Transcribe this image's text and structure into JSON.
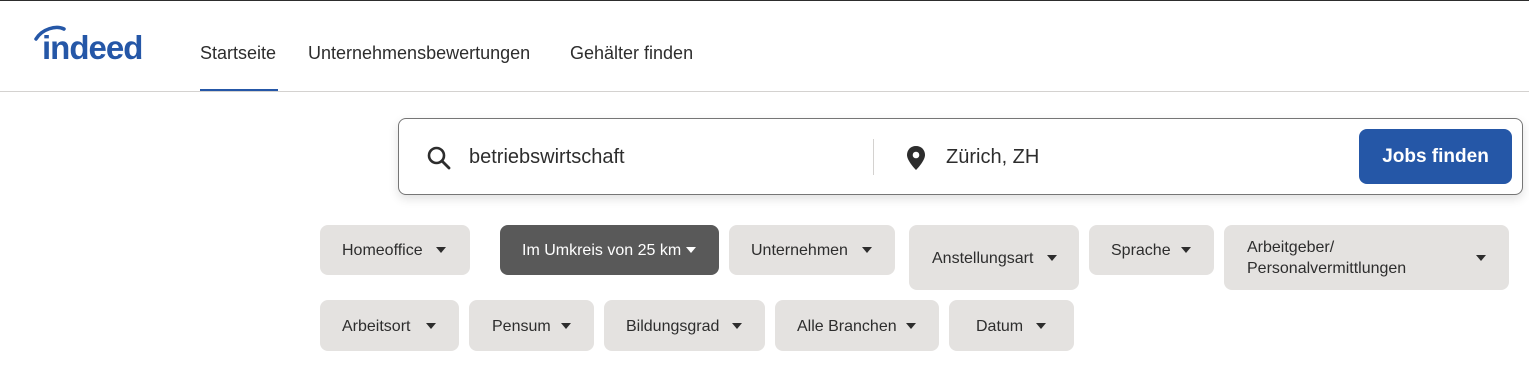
{
  "header": {
    "logo_text": "indeed",
    "nav": [
      {
        "label": "Startseite",
        "active": true
      },
      {
        "label": "Unternehmensbewertungen",
        "active": false
      },
      {
        "label": "Gehälter finden",
        "active": false
      }
    ]
  },
  "search": {
    "what_value": "betriebswirtschaft",
    "where_value": "Zürich, ZH",
    "button_label": "Jobs finden",
    "search_icon": "search-icon",
    "location_icon": "location-pin-icon"
  },
  "filters": {
    "row1": [
      {
        "label": "Homeoffice",
        "selected": false
      },
      {
        "label": "Im Umkreis von 25 km",
        "selected": true
      },
      {
        "label": "Unternehmen",
        "selected": false
      },
      {
        "label": "Anstellungsart",
        "selected": false
      },
      {
        "label": "Sprache",
        "selected": false
      },
      {
        "label_line1": "Arbeitgeber/",
        "label_line2": "Personalvermittlungen",
        "selected": false
      }
    ],
    "row2": [
      {
        "label": "Arbeitsort",
        "selected": false
      },
      {
        "label": "Pensum",
        "selected": false
      },
      {
        "label": "Bildungsgrad",
        "selected": false
      },
      {
        "label": "Alle Branchen",
        "selected": false
      },
      {
        "label": "Datum",
        "selected": false
      }
    ]
  },
  "colors": {
    "brand": "#2557a7",
    "chip_bg": "#e4e2e0",
    "chip_selected_bg": "#595959"
  }
}
